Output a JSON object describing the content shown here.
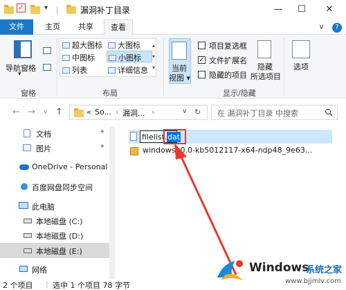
{
  "window": {
    "title": "漏洞补丁目录",
    "qa_arrow": "▾",
    "minimize_glyph": "—",
    "maximize_glyph": "☐",
    "close_glyph": "✕"
  },
  "tabs": [
    {
      "label": "文件"
    },
    {
      "label": "主页"
    },
    {
      "label": "共享"
    },
    {
      "label": "查看"
    }
  ],
  "tabs_right": {
    "collapse": "∨",
    "help": "?"
  },
  "ribbon": {
    "panes": {
      "nav_pane": "导航窗格",
      "group_label": "窗格"
    },
    "layout": {
      "items": [
        "超大图标",
        "大图标",
        "中图标",
        "小图标",
        "列表",
        "详细信息"
      ],
      "selected": "小图标",
      "group_label": "布局"
    },
    "current_view": {
      "line1": "当前",
      "line2": "视图 ▾"
    },
    "show_hide": {
      "item_checkboxes": "项目复选框",
      "file_ext": "文件扩展名",
      "hidden_items": "隐藏的项目",
      "hide_selected_line1": "隐藏",
      "hide_selected_line2": "所选项目",
      "group_label": "显示/隐藏"
    },
    "options": "选项"
  },
  "nav": {
    "back": "←",
    "forward": "→",
    "recent": "∨",
    "up": "↑",
    "breadcrumb": [
      "«",
      "So...",
      "›",
      "漏洞...",
      "›"
    ],
    "dropdown": "∨",
    "refresh": "↻",
    "search_placeholder": "在 漏洞补丁目录 中搜索"
  },
  "sidebar": {
    "items": [
      {
        "label": "文档",
        "pinned": true
      },
      {
        "label": "图片",
        "pinned": true
      },
      {
        "label": "OneDrive - Personal"
      },
      {
        "label": "百度网盘同步空间"
      },
      {
        "label": "此电脑"
      },
      {
        "label": "本地磁盘 (C:)"
      },
      {
        "label": "本地磁盘 (D:)"
      },
      {
        "label": "本地磁盘 (E:)",
        "selected": true
      },
      {
        "label": "网络"
      }
    ]
  },
  "files": {
    "rename_name": "filelist.",
    "rename_ext": "dat",
    "second_file": "windows10.0-kb5012117-x64-ndp48_9e63..."
  },
  "status": {
    "count": "2 个项目",
    "selection": "选中 1 个项目  78 字节"
  },
  "watermark": {
    "brand": "Windows",
    "cn": "系统之家",
    "url": "www.bjjmlv.com"
  },
  "colors": {
    "accent": "#1979ca",
    "selection": "#cce8ff",
    "annotation_red": "#e8392c"
  }
}
